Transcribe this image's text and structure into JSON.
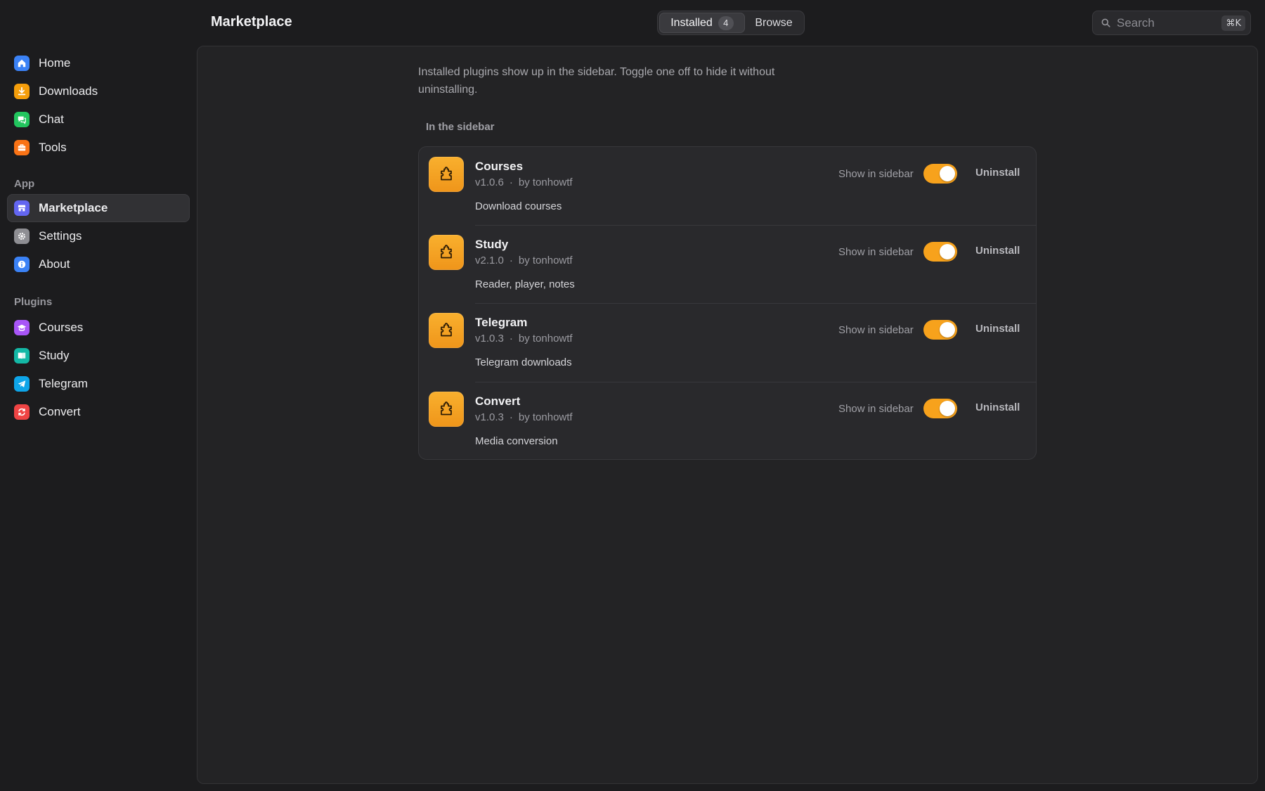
{
  "sidebar": {
    "main_items": [
      {
        "label": "Home",
        "icon": "home-icon",
        "color": "#3b82f6"
      },
      {
        "label": "Downloads",
        "icon": "download-icon",
        "color": "#f59e0b"
      },
      {
        "label": "Chat",
        "icon": "chat-icon",
        "color": "#22c55e"
      },
      {
        "label": "Tools",
        "icon": "toolbox-icon",
        "color": "#f97316"
      }
    ],
    "app_section": "App",
    "app_items": [
      {
        "label": "Marketplace",
        "icon": "store-icon",
        "color": "#6366f1",
        "active": true
      },
      {
        "label": "Settings",
        "icon": "gear-icon",
        "color": "#8e8e93"
      },
      {
        "label": "About",
        "icon": "info-icon",
        "color": "#3b82f6"
      }
    ],
    "plugins_section": "Plugins",
    "plugin_items": [
      {
        "label": "Courses",
        "icon": "graduation-cap-icon",
        "color": "#a855f7"
      },
      {
        "label": "Study",
        "icon": "book-icon",
        "color": "#14b8a6"
      },
      {
        "label": "Telegram",
        "icon": "telegram-icon",
        "color": "#0ea5e9"
      },
      {
        "label": "Convert",
        "icon": "convert-icon",
        "color": "#ef4444"
      }
    ]
  },
  "header": {
    "title": "Marketplace",
    "tabs": {
      "installed": "Installed",
      "installed_count": "4",
      "browse": "Browse"
    },
    "search": {
      "placeholder": "Search",
      "shortcut": "⌘K"
    }
  },
  "main": {
    "intro": "Installed plugins show up in the sidebar. Toggle one off to hide it without uninstalling.",
    "group_label": "In the sidebar",
    "plugins": [
      {
        "name": "Courses",
        "version": "v1.0.6",
        "author": "by tonhowtf",
        "description": "Download courses",
        "toggle_label": "Show in sidebar",
        "enabled": true,
        "uninstall_label": "Uninstall"
      },
      {
        "name": "Study",
        "version": "v2.1.0",
        "author": "by tonhowtf",
        "description": "Reader, player, notes",
        "toggle_label": "Show in sidebar",
        "enabled": true,
        "uninstall_label": "Uninstall"
      },
      {
        "name": "Telegram",
        "version": "v1.0.3",
        "author": "by tonhowtf",
        "description": "Telegram downloads",
        "toggle_label": "Show in sidebar",
        "enabled": true,
        "uninstall_label": "Uninstall"
      },
      {
        "name": "Convert",
        "version": "v1.0.3",
        "author": "by tonhowtf",
        "description": "Media conversion",
        "toggle_label": "Show in sidebar",
        "enabled": true,
        "uninstall_label": "Uninstall"
      }
    ],
    "meta_separator": "·"
  },
  "colors": {
    "accent": "#f7a21c",
    "background": "#1c1c1e",
    "panel": "#232325"
  }
}
